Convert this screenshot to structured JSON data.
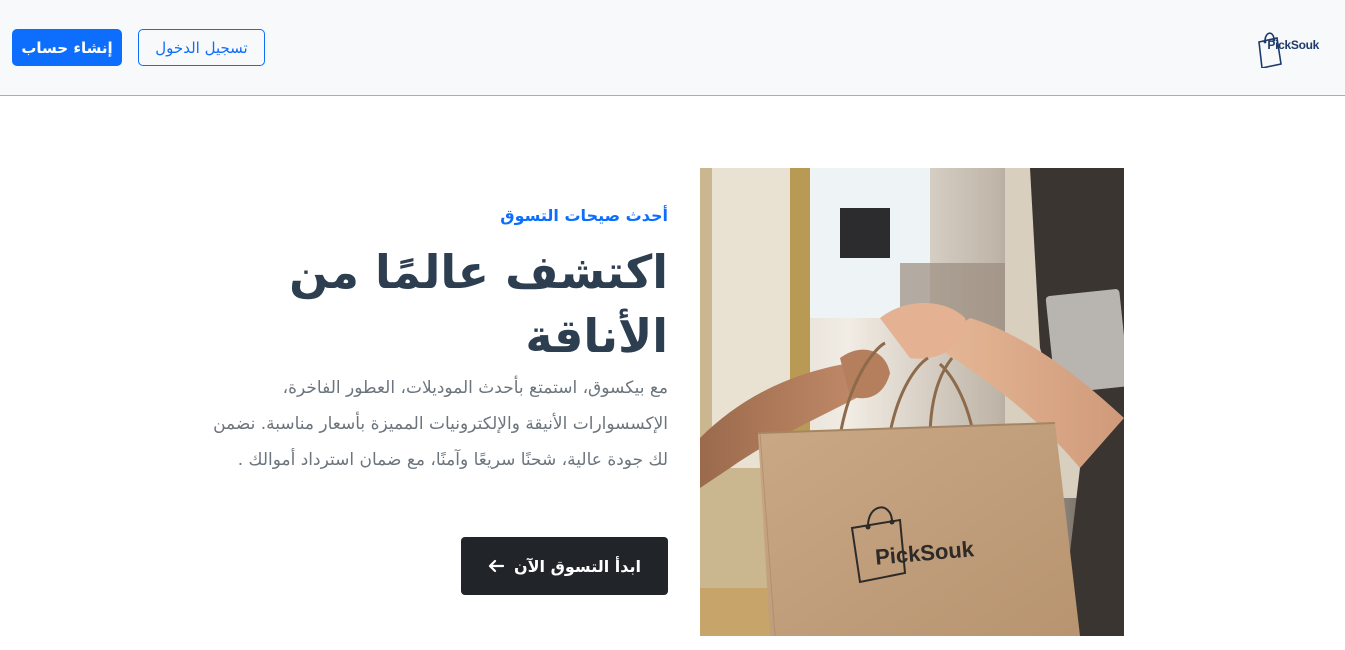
{
  "navbar": {
    "logo_text": "PickSouk",
    "login_label": "تسجيل الدخول",
    "signup_label": "إنشاء حساب"
  },
  "hero": {
    "eyebrow": "أحدث صيحات التسوق",
    "headline": "اكتشف عالمًا من الأناقة",
    "description": "مع بيكسوق، استمتع بأحدث الموديلات، العطور الفاخرة، الإكسسوارات الأنيقة والإلكترونيات المميزة بأسعار مناسبة. نضمن لك جودة عالية، شحنًا سريعًا وآمنًا، مع ضمان استرداد أموالك .",
    "cta_label": "ابدأ التسوق الآن",
    "cta_icon": "arrow-left-icon",
    "bag_print": "PickSouk"
  },
  "colors": {
    "primary": "#0d6efd",
    "dark": "#212529",
    "heading": "#2c3e50",
    "muted": "#6c757d",
    "navbar_bg": "#f8f9fa"
  }
}
